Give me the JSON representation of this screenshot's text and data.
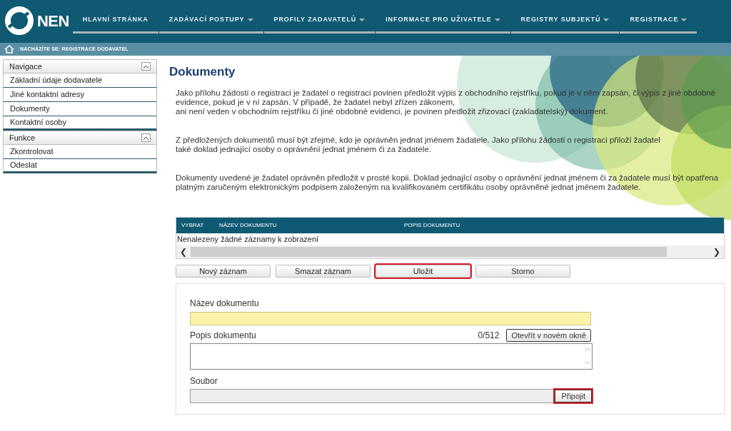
{
  "header": {
    "logo": "NEN",
    "menu": [
      {
        "label": "HLAVNÍ STRÁNKA",
        "dropdown": false
      },
      {
        "label": "ZADÁVACÍ POSTUPY",
        "dropdown": true
      },
      {
        "label": "PROFILY ZADAVATELŮ",
        "dropdown": true
      },
      {
        "label": "INFORMACE PRO UŽIVATELE",
        "dropdown": true
      },
      {
        "label": "REGISTRY SUBJEKTŮ",
        "dropdown": true
      },
      {
        "label": "REGISTRACE",
        "dropdown": true
      }
    ]
  },
  "breadcrumb": "NACHÁZÍTE SE: REGISTRACE DODAVATEL",
  "sidebar": [
    {
      "title": "Navigace",
      "expanded": true,
      "items": [
        "Základní údaje dodavatele",
        "Jiné kontaktní adresy",
        "Dokumenty",
        "Kontaktní osoby"
      ]
    },
    {
      "title": "Funkce",
      "expanded": true,
      "items": [
        "Zkontrolovat",
        "Odeslat"
      ]
    }
  ],
  "page_title": "Dokumenty",
  "paragraphs": [
    [
      "Jako přílohu žádosti o registraci je žadatel o registraci povinen předložit výpis z obchodního rejstříku, pokud je v něm zapsán, či výpis z jiné obdobné",
      "evidence, pokud je v ní zapsán. V případě, že žadatel nebyl zřízen zákonem,",
      "ani není veden v obchodním rejstříku či jiné obdobné evidenci, je povinen předložit zřizovací (zakladatelský) dokument."
    ],
    [
      "Z předložených dokumentů musí být zřejmé, kdo je oprávněn jednat jménem žadatele. Jako přílohu žádosti o registraci přiloží žadatel",
      "také doklad jednající osoby o oprávnění jednat jménem či za žadatele."
    ],
    [
      "Dokumenty uvedené je žadatel oprávněn předložit v prosté kopii. Doklad jednající osoby o oprávnění jednat jménem či za žadatele musí být opatřena",
      "platným zaručeným elektronickým podpisem založeným na kvalifikovaném certifikátu osoby oprávněné jednat jménem žadatele."
    ]
  ],
  "table": {
    "columns": [
      "VYBRAT",
      "NÁZEV DOKUMENTU",
      "POPIS DOKUMENTU"
    ],
    "empty_message": "Nenalezeny žádné záznamy k zobrazení",
    "scroll_left": "❮",
    "scroll_right": "❯"
  },
  "buttons": [
    {
      "label": "Nový záznam",
      "highlighted": false
    },
    {
      "label": "Smazat záznam",
      "highlighted": false
    },
    {
      "label": "Uložit",
      "highlighted": true
    },
    {
      "label": "Storno",
      "highlighted": false
    }
  ],
  "form": {
    "name_label": "Název dokumentu",
    "description_label": "Popis dokumentu",
    "counter": "0/512",
    "open_button": {
      "label": "Otevřít v novém okně",
      "highlighted": false
    },
    "file_label": "Soubor",
    "attach_button": {
      "label": "Připojit",
      "highlighted": true
    }
  }
}
